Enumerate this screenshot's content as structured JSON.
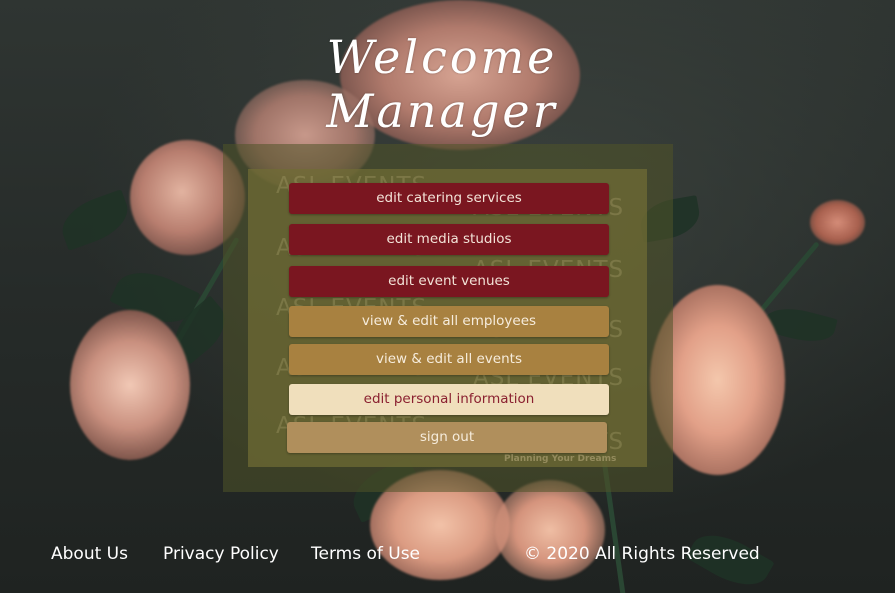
{
  "header": {
    "title": "Welcome Manager"
  },
  "panel": {
    "watermark_text": "ASL EVENTS",
    "tagline": "Planning Your Dreams"
  },
  "menu": {
    "items": [
      {
        "label": "edit catering services"
      },
      {
        "label": "edit media studios"
      },
      {
        "label": "edit event venues"
      },
      {
        "label": "view & edit all employees"
      },
      {
        "label": "view & edit all events"
      },
      {
        "label": "edit personal information"
      },
      {
        "label": "sign out"
      }
    ]
  },
  "footer": {
    "about": "About Us",
    "privacy": "Privacy Policy",
    "terms": "Terms of Use",
    "copyright": "© 2020 All Rights Reserved"
  },
  "colors": {
    "primary_button": "#7a1620",
    "secondary_button": "#a88140",
    "highlight_button": "#f0dfbc",
    "signout_button": "#b08f5c",
    "panel": "#706c34"
  }
}
